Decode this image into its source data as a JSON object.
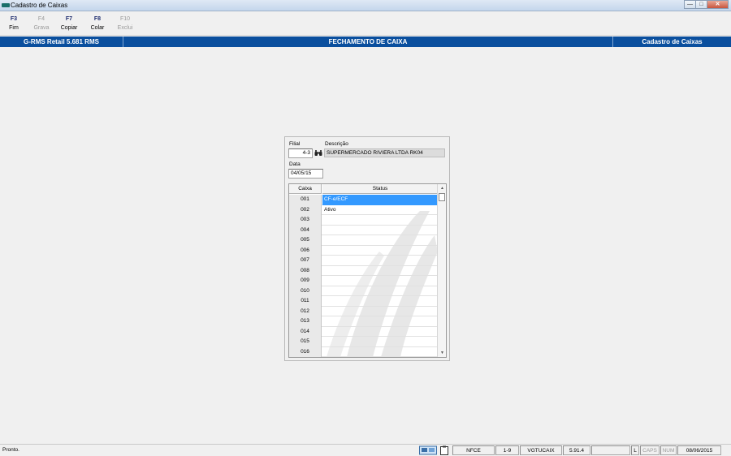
{
  "window": {
    "title": "Cadastro de Caixas"
  },
  "toolbar": {
    "keys": [
      {
        "key": "F3",
        "label": "Fim",
        "enabled": true
      },
      {
        "key": "F4",
        "label": "Grava",
        "enabled": false
      },
      {
        "key": "F7",
        "label": "Copiar",
        "enabled": true
      },
      {
        "key": "F8",
        "label": "Colar",
        "enabled": true
      },
      {
        "key": "F10",
        "label": "Exclui",
        "enabled": false
      }
    ]
  },
  "header": {
    "left": "G-RMS Retail 5.681 RMS",
    "center": "FECHAMENTO DE CAIXA",
    "right": "Cadastro de Caixas",
    "color": "#0a4f9e"
  },
  "form": {
    "filial_label": "Filial",
    "filial_value": "4-3",
    "descricao_label": "Descrição",
    "descricao_value": "SUPERMERCADO RIVIERA LTDA RK04",
    "data_label": "Data",
    "data_value": "04/05/15",
    "lookup_icon": "binoculars-icon"
  },
  "grid": {
    "columns": [
      "Caixa",
      "Status"
    ],
    "rows": [
      {
        "caixa": "001",
        "status": "CF-e/ECF",
        "selected": true
      },
      {
        "caixa": "002",
        "status": "Ativo"
      },
      {
        "caixa": "003",
        "status": ""
      },
      {
        "caixa": "004",
        "status": ""
      },
      {
        "caixa": "005",
        "status": ""
      },
      {
        "caixa": "006",
        "status": ""
      },
      {
        "caixa": "007",
        "status": ""
      },
      {
        "caixa": "008",
        "status": ""
      },
      {
        "caixa": "009",
        "status": ""
      },
      {
        "caixa": "010",
        "status": ""
      },
      {
        "caixa": "011",
        "status": ""
      },
      {
        "caixa": "012",
        "status": ""
      },
      {
        "caixa": "013",
        "status": ""
      },
      {
        "caixa": "014",
        "status": ""
      },
      {
        "caixa": "015",
        "status": ""
      },
      {
        "caixa": "016",
        "status": ""
      }
    ],
    "selection_color": "#3399ff"
  },
  "statusbar": {
    "message": "Pronto.",
    "cells": [
      "NFCE",
      "1-9",
      "VGTUCAIX",
      "5.91.4",
      "",
      "L",
      "CAPS",
      "NUM",
      "08/06/2015"
    ]
  }
}
